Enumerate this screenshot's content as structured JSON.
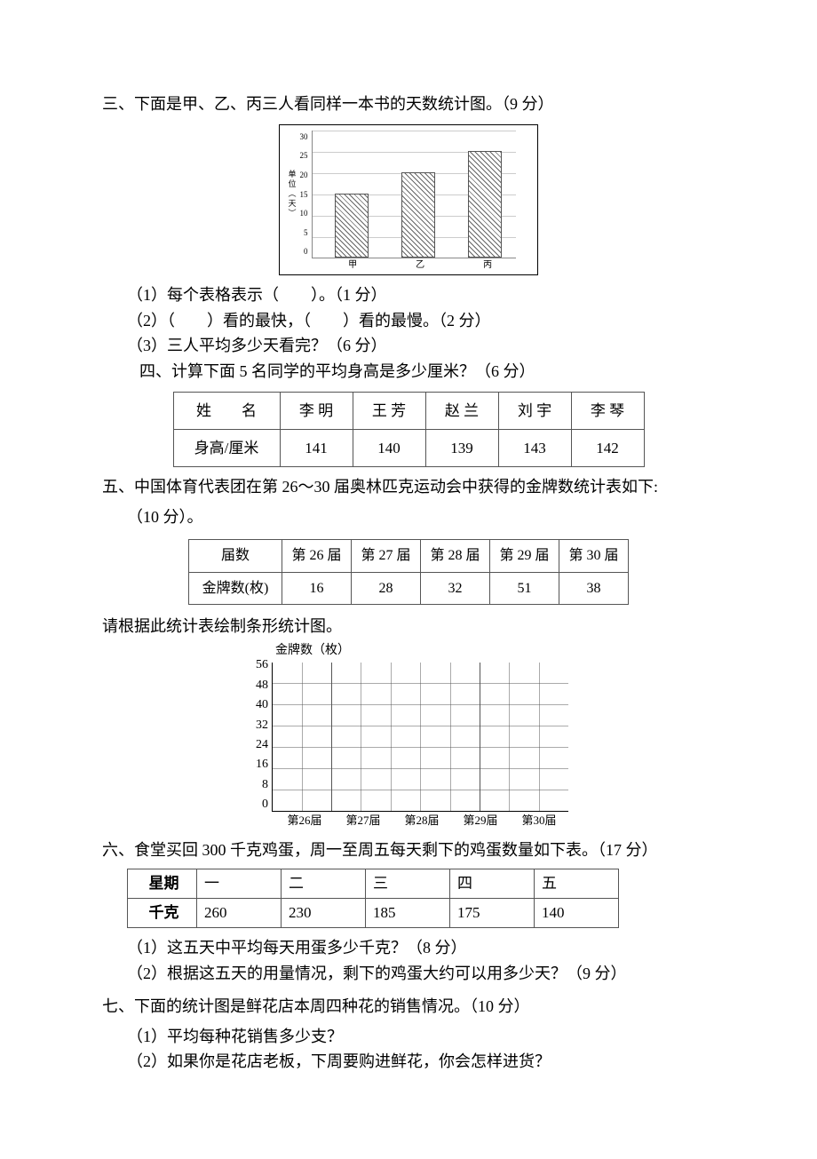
{
  "section3": {
    "title": "三、下面是甲、乙、丙三人看同样一本书的天数统计图。（9 分）",
    "q1": "（1）每个表格表示（　　）。（1 分）",
    "q2": "（2）（　　）看的最快，（　　）看的最慢。（2 分）",
    "q3": "（3）三人平均多少天看完？（6 分）"
  },
  "section4": {
    "title": "四、计算下面 5 名同学的平均身高是多少厘米？（6 分）",
    "row_label_name": "姓　　名",
    "row_label_height": "身高/厘米",
    "students": [
      {
        "name": "李 明",
        "height": "141"
      },
      {
        "name": "王 芳",
        "height": "140"
      },
      {
        "name": "赵 兰",
        "height": "139"
      },
      {
        "name": "刘 宇",
        "height": "143"
      },
      {
        "name": "李 琴",
        "height": "142"
      }
    ]
  },
  "section5": {
    "title": "五、中国体育代表团在第 26～30 届奥林匹克运动会中获得的金牌数统计表如下:",
    "points": "（10 分）。",
    "row_label_session": "届数",
    "row_label_gold": "金牌数(枚)",
    "rows": [
      {
        "session": "第 26 届",
        "gold": "16"
      },
      {
        "session": "第 27 届",
        "gold": "28"
      },
      {
        "session": "第 28 届",
        "gold": "32"
      },
      {
        "session": "第 29 届",
        "gold": "51"
      },
      {
        "session": "第 30 届",
        "gold": "38"
      }
    ],
    "instruction": "请根据此统计表绘制条形统计图。",
    "chart_ylabel": "金牌数（枚）",
    "yticks": [
      "56",
      "48",
      "40",
      "32",
      "24",
      "16",
      "8",
      "0"
    ],
    "xticks": [
      "第26届",
      "第27届",
      "第28届",
      "第29届",
      "第30届"
    ]
  },
  "section6": {
    "title": "六、食堂买回 300 千克鸡蛋，周一至周五每天剩下的鸡蛋数量如下表。（17 分）",
    "row_label_day": "星期",
    "row_label_kg": "千克",
    "days": [
      {
        "day": "一",
        "kg": "260"
      },
      {
        "day": "二",
        "kg": "230"
      },
      {
        "day": "三",
        "kg": "185"
      },
      {
        "day": "四",
        "kg": "175"
      },
      {
        "day": "五",
        "kg": "140"
      }
    ],
    "q1": "（1）这五天中平均每天用蛋多少千克？（8 分）",
    "q2": "（2）根据这五天的用量情况，剩下的鸡蛋大约可以用多少天？（9 分）"
  },
  "section7": {
    "title": "七、下面的统计图是鲜花店本周四种花的销售情况。（10 分）",
    "q1": "（1）平均每种花销售多少支？",
    "q2": "（2）如果你是花店老板，下周要购进鲜花，你会怎样进货？"
  },
  "chart_data": [
    {
      "type": "bar",
      "title": "甲、乙、丙三人看同样一本书的天数统计图",
      "categories": [
        "甲",
        "乙",
        "丙"
      ],
      "values": [
        15,
        20,
        25
      ],
      "ylabel": "单位（天）",
      "ylim": [
        0,
        30
      ],
      "yticks": [
        0,
        5,
        10,
        15,
        20,
        25,
        30
      ]
    },
    {
      "type": "bar",
      "title": "金牌数（枚）",
      "categories": [
        "第26届",
        "第27届",
        "第28届",
        "第29届",
        "第30届"
      ],
      "values": [
        null,
        null,
        null,
        null,
        null
      ],
      "ylim": [
        0,
        56
      ],
      "yticks": [
        0,
        8,
        16,
        24,
        32,
        40,
        48,
        56
      ],
      "note": "blank grid for student to fill"
    }
  ],
  "c1": {
    "ylabel": "单位（天）",
    "yticks": [
      "30",
      "25",
      "20",
      "15",
      "10",
      "5",
      "0"
    ],
    "cats": {
      "a": "甲",
      "b": "乙",
      "c": "丙"
    }
  }
}
